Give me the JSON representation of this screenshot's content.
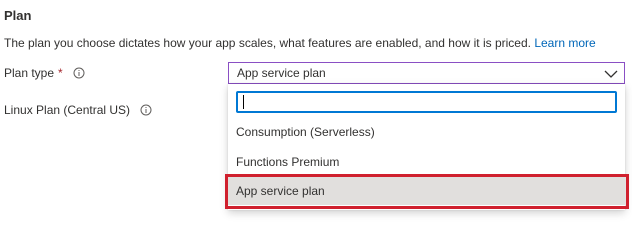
{
  "section": {
    "title": "Plan",
    "description": "The plan you choose dictates how your app scales, what features are enabled, and how it is priced.",
    "learn_more": "Learn more"
  },
  "plan_type": {
    "label": "Plan type",
    "required_mark": "*",
    "selected_value": "App service plan"
  },
  "linux_plan": {
    "label": "Linux Plan (Central US)"
  },
  "dropdown": {
    "search_value": "",
    "options": [
      {
        "label": "Consumption (Serverless)"
      },
      {
        "label": "Functions Premium"
      },
      {
        "label": "App service plan"
      }
    ],
    "selected_index": 2
  },
  "icons": {
    "info": "info-icon",
    "chevron": "chevron-down-icon"
  },
  "colors": {
    "link": "#0066b8",
    "required": "#a4262c",
    "focus_border": "#0078d4",
    "select_border": "#8a4fc4",
    "selected_option_bg": "#e1dfdd",
    "highlight": "#d0202e"
  }
}
